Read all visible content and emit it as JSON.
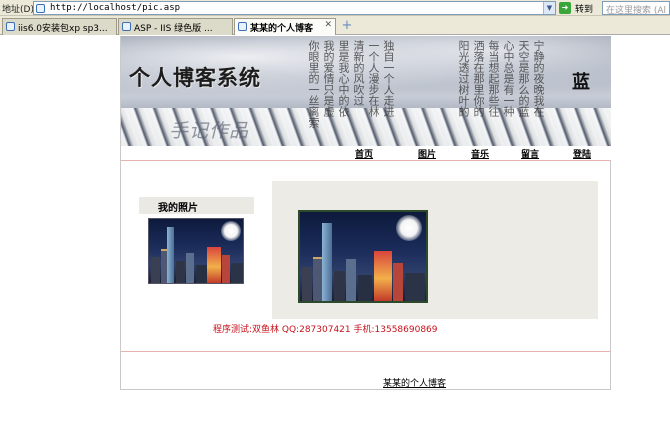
{
  "browser": {
    "address_label": "地址(D)",
    "url": "http://localhost/pic.asp",
    "go_label": "转到",
    "search_placeholder": "在这里搜索 (Al",
    "tabs": [
      {
        "label": "iis6.0安装包xp sp3..."
      },
      {
        "label": "ASP - IIS 绿色版 ..."
      },
      {
        "label": "某某的个人博客"
      }
    ]
  },
  "banner": {
    "title": "个人博客系统",
    "subtitle": "手记作品",
    "blue": "蓝",
    "poem_columns": [
      "你眼里的一丝离索",
      "我的爱情只是虚",
      "里是我心中的依",
      "清新的风吹过",
      "一个人漫步在林",
      "独自一个人走进",
      "阳光透过树叶的",
      "洒落在那里你的",
      "每当想起那些往",
      "心中总是有一种",
      "天空是那么的蓝",
      "宁静的夜晚我在"
    ]
  },
  "nav": {
    "items": [
      {
        "label": "首页"
      },
      {
        "label": "图片"
      },
      {
        "label": "音乐"
      },
      {
        "label": "留言"
      },
      {
        "label": "登陆"
      }
    ]
  },
  "sidebar": {
    "title": "我的照片"
  },
  "credit": "程序测试:双鱼林 QQ:287307421 手机:13558690869",
  "footer": {
    "link": "某某的个人博客"
  },
  "colors": {
    "credit": "#c8101a",
    "nav_separator": "#e7b4b4",
    "panel": "#ecebe6"
  }
}
